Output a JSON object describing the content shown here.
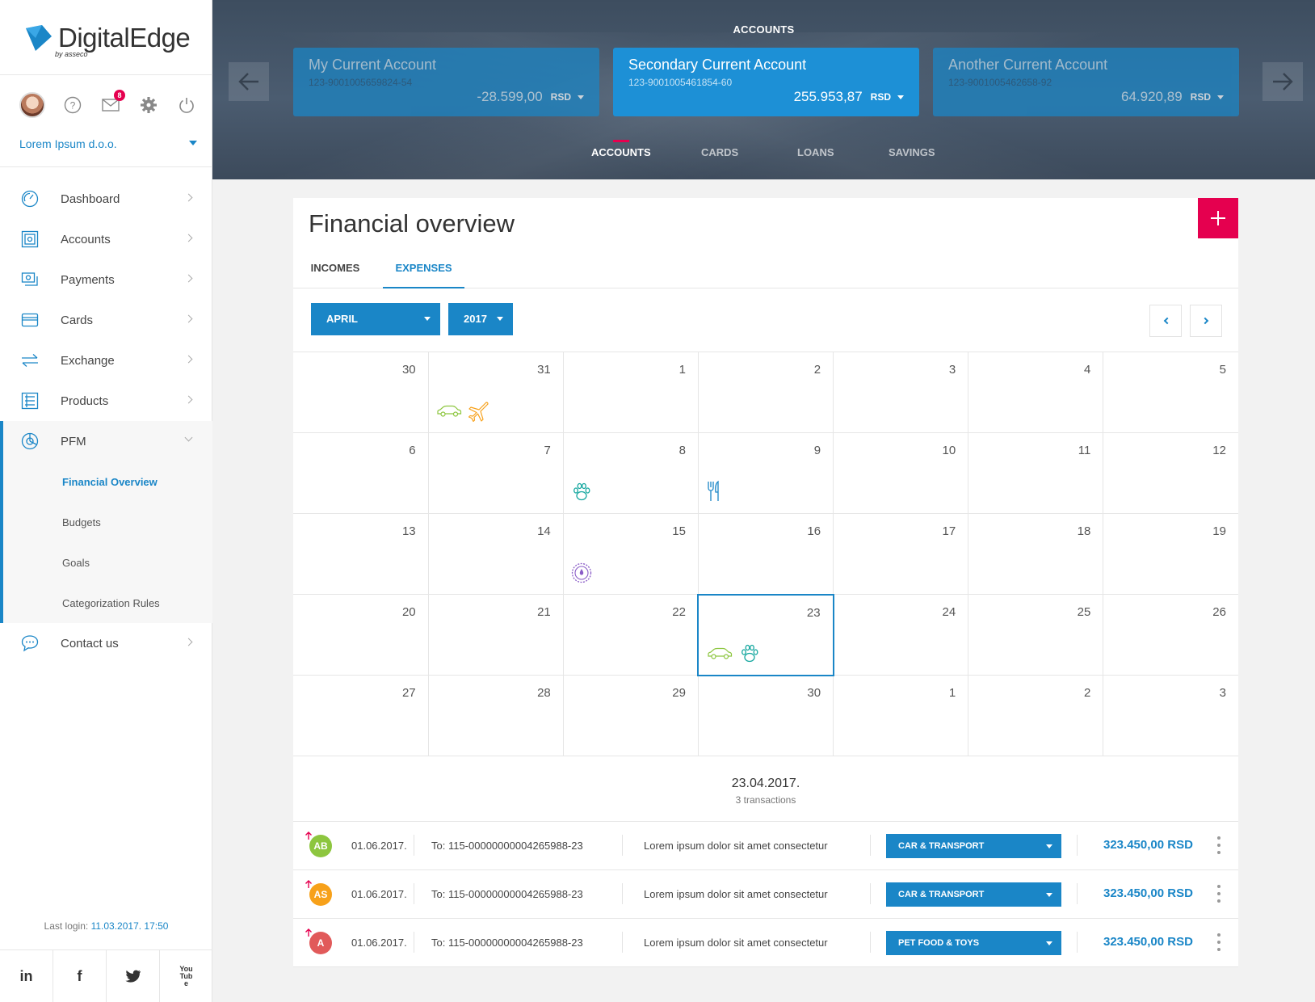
{
  "brand": {
    "name": "DigitalEdge",
    "sub": "by asseco"
  },
  "user": {
    "messages_badge": "8",
    "company": "Lorem Ipsum d.o.o."
  },
  "nav": {
    "items": [
      {
        "label": "Dashboard",
        "icon": "dashboard-gauge-icon"
      },
      {
        "label": "Accounts",
        "icon": "safe-icon"
      },
      {
        "label": "Payments",
        "icon": "payments-icon"
      },
      {
        "label": "Cards",
        "icon": "card-icon"
      },
      {
        "label": "Exchange",
        "icon": "exchange-arrows-icon"
      },
      {
        "label": "Products",
        "icon": "products-list-icon"
      }
    ],
    "pfm": {
      "label": "PFM",
      "icon": "pfm-pie-icon",
      "sub": [
        "Financial Overview",
        "Budgets",
        "Goals",
        "Categorization Rules"
      ]
    },
    "contact": {
      "label": "Contact us",
      "icon": "chat-bubble-icon"
    }
  },
  "last_login": {
    "label": "Last login:",
    "value": "11.03.2017. 17:50"
  },
  "social": [
    "in",
    "f",
    "twitter",
    "YouTube"
  ],
  "header": {
    "title": "ACCOUNTS",
    "accounts": [
      {
        "name": "My Current Account",
        "number": "123-9001005659824-54",
        "balance": "-28.599,00",
        "currency": "RSD"
      },
      {
        "name": "Secondary Current Account",
        "number": "123-9001005461854-60",
        "balance": "255.953,87",
        "currency": "RSD"
      },
      {
        "name": "Another Current Account",
        "number": "123-9001005462658-92",
        "balance": "64.920,89",
        "currency": "RSD"
      }
    ],
    "tabs": [
      "ACCOUNTS",
      "CARDS",
      "LOANS",
      "SAVINGS"
    ]
  },
  "overview": {
    "title": "Financial overview",
    "tabs": [
      "INCOMES",
      "EXPENSES"
    ],
    "month": "APRIL",
    "year": "2017"
  },
  "calendar": {
    "days": [
      "30",
      "31",
      "1",
      "2",
      "3",
      "4",
      "5",
      "6",
      "7",
      "8",
      "9",
      "10",
      "11",
      "12",
      "13",
      "14",
      "15",
      "16",
      "17",
      "18",
      "19",
      "20",
      "21",
      "22",
      "23",
      "24",
      "25",
      "26",
      "27",
      "28",
      "29",
      "30",
      "1",
      "2",
      "3"
    ]
  },
  "day_summary": {
    "date": "23.04.2017.",
    "count": "3 transactions"
  },
  "transactions": [
    {
      "initials": "AB",
      "color": "#8dc63f",
      "date": "01.06.2017.",
      "to": "To: 115-00000000004265988-23",
      "desc": "Lorem ipsum dolor sit amet consectetur",
      "category": "CAR & TRANSPORT",
      "amount": "323.450,00 RSD"
    },
    {
      "initials": "AS",
      "color": "#f7a11a",
      "date": "01.06.2017.",
      "to": "To: 115-00000000004265988-23",
      "desc": "Lorem ipsum dolor sit amet consectetur",
      "category": "CAR & TRANSPORT",
      "amount": "323.450,00 RSD"
    },
    {
      "initials": "A",
      "color": "#e15a5a",
      "date": "01.06.2017.",
      "to": "To: 115-00000000004265988-23",
      "desc": "Lorem ipsum dolor sit amet consectetur",
      "category": "PET FOOD & TOYS",
      "amount": "323.450,00 RSD"
    }
  ],
  "colors": {
    "accent": "#1a86c7",
    "brand_pink": "#e5004f"
  }
}
